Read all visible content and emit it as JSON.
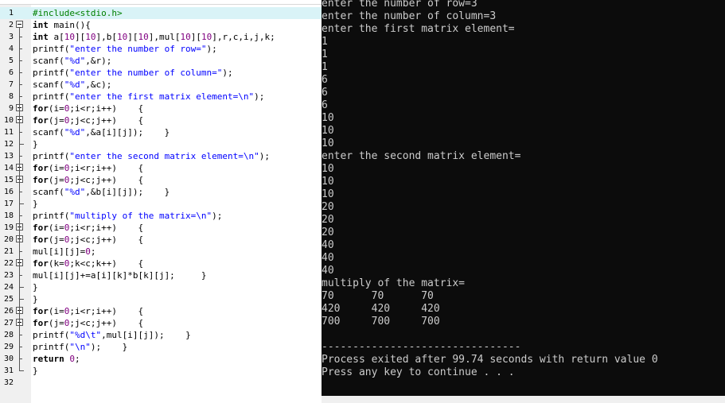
{
  "editor": {
    "lines": [
      {
        "n": "1",
        "t": "#include<stdio.h>"
      },
      {
        "n": "2",
        "t": "int main(){"
      },
      {
        "n": "3",
        "t": "int a[10][10],b[10][10],mul[10][10],r,c,i,j,k;"
      },
      {
        "n": "4",
        "t": "printf(\"enter the number of row=\");"
      },
      {
        "n": "5",
        "t": "scanf(\"%d\",&r);"
      },
      {
        "n": "6",
        "t": "printf(\"enter the number of column=\");"
      },
      {
        "n": "7",
        "t": "scanf(\"%d\",&c);"
      },
      {
        "n": "8",
        "t": "printf(\"enter the first matrix element=\\n\");"
      },
      {
        "n": "9",
        "t": "for(i=0;i<r;i++)    {"
      },
      {
        "n": "10",
        "t": "for(j=0;j<c;j++)    {"
      },
      {
        "n": "11",
        "t": "scanf(\"%d\",&a[i][j]);    }"
      },
      {
        "n": "12",
        "t": "}"
      },
      {
        "n": "13",
        "t": "printf(\"enter the second matrix element=\\n\");"
      },
      {
        "n": "14",
        "t": "for(i=0;i<r;i++)    {"
      },
      {
        "n": "15",
        "t": "for(j=0;j<c;j++)    {"
      },
      {
        "n": "16",
        "t": "scanf(\"%d\",&b[i][j]);    }"
      },
      {
        "n": "17",
        "t": "}"
      },
      {
        "n": "18",
        "t": "printf(\"multiply of the matrix=\\n\");"
      },
      {
        "n": "19",
        "t": "for(i=0;i<r;i++)    {"
      },
      {
        "n": "20",
        "t": "for(j=0;j<c;j++)    {"
      },
      {
        "n": "21",
        "t": "mul[i][j]=0;"
      },
      {
        "n": "22",
        "t": "for(k=0;k<c;k++)    {"
      },
      {
        "n": "23",
        "t": "mul[i][j]+=a[i][k]*b[k][j];     }"
      },
      {
        "n": "24",
        "t": "}"
      },
      {
        "n": "25",
        "t": "}"
      },
      {
        "n": "26",
        "t": "for(i=0;i<r;i++)    {"
      },
      {
        "n": "27",
        "t": "for(j=0;j<c;j++)    {"
      },
      {
        "n": "28",
        "t": "printf(\"%d\\t\",mul[i][j]);    }"
      },
      {
        "n": "29",
        "t": "printf(\"\\n\");    }"
      },
      {
        "n": "30",
        "t": "return 0;"
      },
      {
        "n": "31",
        "t": "}"
      },
      {
        "n": "32",
        "t": ""
      }
    ]
  },
  "console": {
    "lines": [
      "enter the number of row=3",
      "enter the number of column=3",
      "enter the first matrix element=",
      "1",
      "1",
      "1",
      "6",
      "6",
      "6",
      "10",
      "10",
      "10",
      "enter the second matrix element=",
      "10",
      "10",
      "10",
      "20",
      "20",
      "20",
      "40",
      "40",
      "40",
      "multiply of the matrix=",
      "70      70      70",
      "420     420     420",
      "700     700     700",
      "",
      "--------------------------------",
      "Process exited after 99.74 seconds with return value 0",
      "Press any key to continue . . ."
    ]
  },
  "colors": {
    "console_bg": "#0c0c0c",
    "console_fg": "#cccccc",
    "current_line": "#d9f3f7",
    "keyword": "#000000",
    "preprocessor": "#008000",
    "string": "#0000ff",
    "number": "#800080"
  }
}
